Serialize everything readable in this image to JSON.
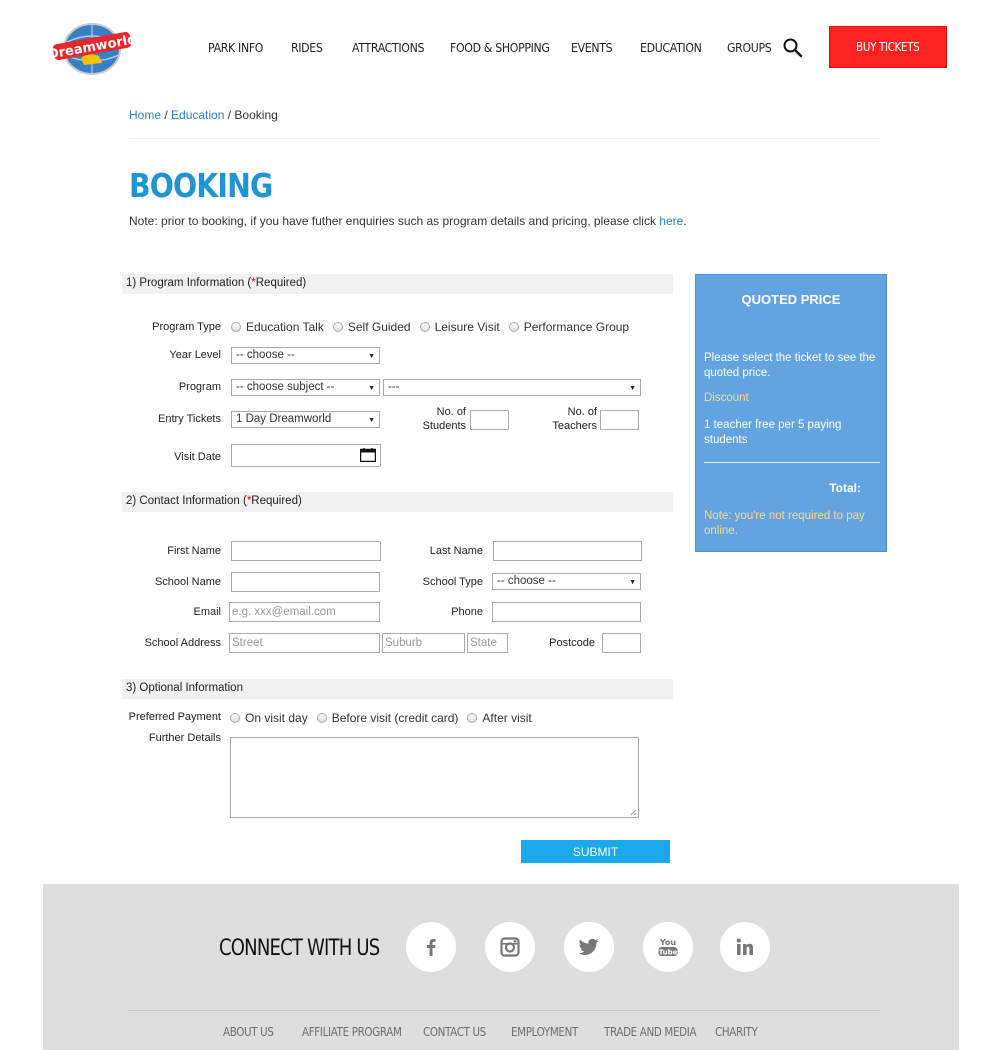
{
  "header": {
    "logo_text": "Dreamworld",
    "nav": [
      "PARK INFO",
      "RIDES",
      "ATTRACTIONS",
      "FOOD & SHOPPING",
      "EVENTS",
      "EDUCATION",
      "GROUPS"
    ],
    "buy_tickets": "BUY TICKETS"
  },
  "breadcrumb": {
    "home": "Home",
    "sep1": " / ",
    "education": "Education",
    "sep2": " / ",
    "current": "Booking"
  },
  "page": {
    "title": "BOOKING",
    "note_prefix": "Note: prior to booking, if you have futher enquiries such as program details and pricing, please click ",
    "note_link": "here",
    "note_suffix": "."
  },
  "section1": {
    "title_prefix": "1) Program Information (",
    "star": "*",
    "title_suffix": "Required)",
    "program_type_label": "Program Type",
    "program_types": [
      "Education Talk",
      "Self Guided",
      "Leisure Visit",
      "Performance Group"
    ],
    "year_level_label": "Year Level",
    "year_level_value": "-- choose --",
    "program_label": "Program",
    "program_subject_value": "-- choose subject --",
    "program_value": "---",
    "entry_tickets_label": "Entry Tickets",
    "entry_tickets_value": "1 Day Dreamworld",
    "students_label_1": "No. of",
    "students_label_2": "Students",
    "teachers_label_1": "No. of",
    "teachers_label_2": "Teachers",
    "visit_date_label": "Visit Date"
  },
  "section2": {
    "title_prefix": "2) Contact Information (",
    "star": "*",
    "title_suffix": "Required)",
    "first_name_label": "First Name",
    "last_name_label": "Last Name",
    "school_name_label": "School Name",
    "school_type_label": "School Type",
    "school_type_value": "-- choose --",
    "email_label": "Email",
    "email_placeholder": "e.g. xxx@email.com",
    "phone_label": "Phone",
    "address_label": "School Address",
    "street_placeholder": "Street",
    "suburb_placeholder": "Suburb",
    "state_placeholder": "State",
    "postcode_label": "Postcode"
  },
  "section3": {
    "title": "3) Optional Information",
    "payment_label": "Preferred Payment",
    "payment_options": [
      "On visit day",
      "Before visit (credit card)",
      "After visit"
    ],
    "details_label": "Further Details"
  },
  "submit": "SUBMIT",
  "price_panel": {
    "title": "QUOTED PRICE",
    "message": "Please select the ticket to see the quoted price.",
    "discount_label": "Discount",
    "discount_text": "1 teacher free per 5 paying students",
    "total_label": "Total:",
    "note": "Note: you're not required to pay online."
  },
  "footer": {
    "connect": "CONNECT WITH US",
    "social_icons": [
      "facebook-icon",
      "instagram-icon",
      "twitter-icon",
      "youtube-icon",
      "linkedin-icon"
    ],
    "youtube_you": "You",
    "youtube_tube": "Tube",
    "links": [
      "ABOUT US",
      "AFFILIATE PROGRAM",
      "CONTACT US",
      "EMPLOYMENT",
      "TRADE AND MEDIA",
      "CHARITY"
    ]
  },
  "colors": {
    "brand_blue": "#1f95d3",
    "buy_red": "#ff2222",
    "panel_blue": "#62a3e0",
    "submit_blue": "#1aa9ea",
    "discount_gold": "#ffd98c"
  }
}
